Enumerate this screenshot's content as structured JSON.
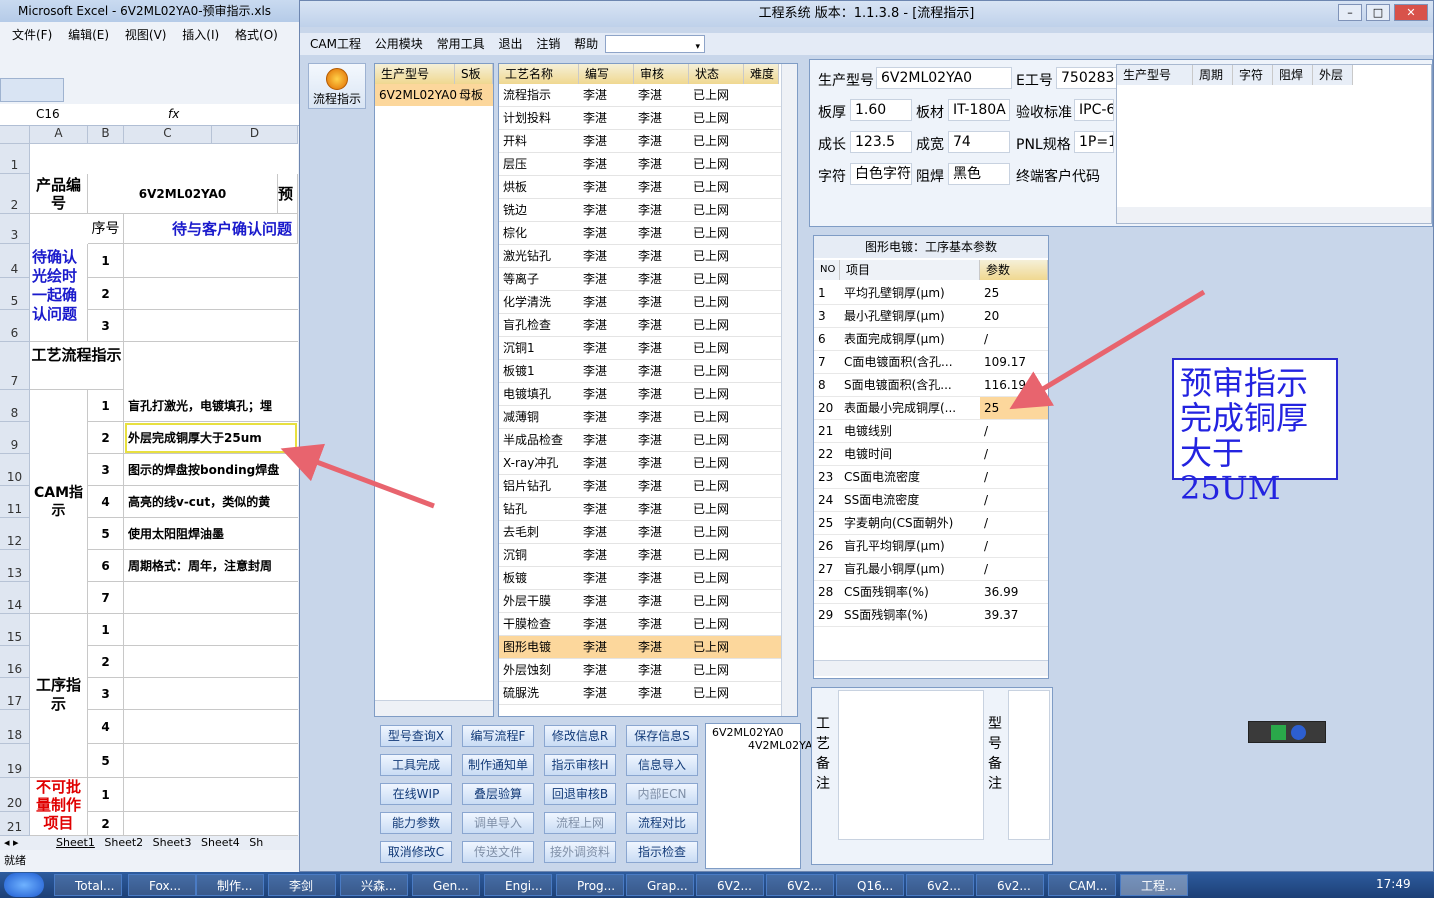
{
  "excel": {
    "title": "Microsoft Excel - 6V2ML02YA0-预审指示.xls",
    "menu": [
      "文件(F)",
      "编辑(E)",
      "视图(V)",
      "插入(I)",
      "格式(O)"
    ],
    "cellref": "C16",
    "fx": "fx",
    "cols": [
      "A",
      "B",
      "C",
      "D"
    ],
    "rows": [
      "1",
      "2",
      "3",
      "4",
      "5",
      "6",
      "7",
      "8",
      "9",
      "10",
      "11",
      "12",
      "13",
      "14",
      "15",
      "16",
      "17",
      "18",
      "19",
      "20",
      "21"
    ],
    "product_label": "产品编号",
    "product_no": "6V2ML02YA0",
    "pre": "预",
    "seq": "序号",
    "pending": "待与客户确认问题",
    "confirm_label": "待确认光绘时一起确认问题",
    "process_label": "工艺流程指示",
    "cam_label": "CAM指示",
    "step_label": "工序指示",
    "noprod_label": "不可批量制作项目",
    "nums": [
      "1",
      "2",
      "3",
      "1",
      "2",
      "3",
      "4",
      "5",
      "6",
      "7",
      "1",
      "2",
      "3",
      "4",
      "5",
      "1",
      "2"
    ],
    "cam_items": [
      "盲孔打激光，电镀填孔；埋",
      "外层完成铜厚大于25um",
      "图示的焊盘按bonding焊盘",
      "高亮的线v-cut，类似的黄",
      "使用太阳阻焊油墨",
      "周期格式：周年，注意封周"
    ],
    "sheets": [
      "Sheet1",
      "Sheet2",
      "Sheet3",
      "Sheet4",
      "Sh"
    ],
    "status": "就绪"
  },
  "app": {
    "title": "工程系统  版本：1.1.3.8 - [流程指示]",
    "menu": [
      "CAM工程",
      "公用模块",
      "常用工具",
      "退出",
      "注销",
      "帮助"
    ],
    "flow_btn": "流程指示",
    "model_hdr": [
      "生产型号",
      "S板"
    ],
    "model_row": [
      "6V2ML02YA0",
      "母板"
    ],
    "proc_hdr": [
      "工艺名称",
      "编写",
      "审核",
      "状态",
      "难度"
    ],
    "processes": [
      [
        "流程指示",
        "李湛",
        "李湛",
        "已上网"
      ],
      [
        "计划投料",
        "李湛",
        "李湛",
        "已上网"
      ],
      [
        "开料",
        "李湛",
        "李湛",
        "已上网"
      ],
      [
        "层压",
        "李湛",
        "李湛",
        "已上网"
      ],
      [
        "烘板",
        "李湛",
        "李湛",
        "已上网"
      ],
      [
        "铣边",
        "李湛",
        "李湛",
        "已上网"
      ],
      [
        "棕化",
        "李湛",
        "李湛",
        "已上网"
      ],
      [
        "激光钻孔",
        "李湛",
        "李湛",
        "已上网"
      ],
      [
        "等离子",
        "李湛",
        "李湛",
        "已上网"
      ],
      [
        "化学清洗",
        "李湛",
        "李湛",
        "已上网"
      ],
      [
        "盲孔检查",
        "李湛",
        "李湛",
        "已上网"
      ],
      [
        "沉铜1",
        "李湛",
        "李湛",
        "已上网"
      ],
      [
        "板镀1",
        "李湛",
        "李湛",
        "已上网"
      ],
      [
        "电镀填孔",
        "李湛",
        "李湛",
        "已上网"
      ],
      [
        "减薄铜",
        "李湛",
        "李湛",
        "已上网"
      ],
      [
        "半成品检查",
        "李湛",
        "李湛",
        "已上网"
      ],
      [
        "X-ray冲孔",
        "李湛",
        "李湛",
        "已上网"
      ],
      [
        "铝片钻孔",
        "李湛",
        "李湛",
        "已上网"
      ],
      [
        "钻孔",
        "李湛",
        "李湛",
        "已上网"
      ],
      [
        "去毛刺",
        "李湛",
        "李湛",
        "已上网"
      ],
      [
        "沉铜",
        "李湛",
        "李湛",
        "已上网"
      ],
      [
        "板镀",
        "李湛",
        "李湛",
        "已上网"
      ],
      [
        "外层干膜",
        "李湛",
        "李湛",
        "已上网"
      ],
      [
        "干膜检查",
        "李湛",
        "李湛",
        "已上网"
      ],
      [
        "图形电镀",
        "李湛",
        "李湛",
        "已上网"
      ],
      [
        "外层蚀刻",
        "李湛",
        "李湛",
        "已上网"
      ],
      [
        "硫脲洗",
        "李湛",
        "李湛",
        "已上网"
      ]
    ],
    "buttons": [
      [
        "型号查询X",
        "编写流程F",
        "修改信息R",
        "保存信息S"
      ],
      [
        "工具完成",
        "制作通知单",
        "指示审核H",
        "信息导入"
      ],
      [
        "在线WIP",
        "叠层验算",
        "回退审核B",
        "内部ECN"
      ],
      [
        "能力参数",
        "调单导入",
        "流程上网",
        "流程对比"
      ],
      [
        "取消修改C",
        "传送文件",
        "接外调资料",
        "指示检查"
      ]
    ],
    "disabled": [
      "内部ECN",
      "调单导入",
      "流程上网",
      "传送文件",
      "接外调资料"
    ],
    "tree": [
      "6V2ML02YA0",
      "4V2ML02YA"
    ],
    "info": {
      "model_label": "生产型号",
      "model": "6V2ML02YA0",
      "eng_label": "E工号",
      "eng": "750283",
      "thick_label": "板厚",
      "thick": "1.60",
      "mat_label": "板材",
      "mat": "IT-180A",
      "std_label": "验收标准",
      "std": "IPC-6",
      "len_label": "成长",
      "len": "123.5",
      "wid_label": "成宽",
      "wid": "74",
      "pnl_label": "PNL规格",
      "pnl": "1P=1",
      "char_label": "字符",
      "char": "白色字符",
      "mask_label": "阻焊",
      "mask": "黑色",
      "cust_label": "终端客户代码"
    },
    "right_hdr": [
      "生产型号",
      "周期",
      "字符",
      "阻焊",
      "外层"
    ],
    "param_title": "图形电镀：工序基本参数",
    "param_hdr": [
      "NO",
      "项目",
      "参数"
    ],
    "params": [
      [
        "1",
        "平均孔壁铜厚(μm)",
        "25"
      ],
      [
        "3",
        "最小孔壁铜厚(μm)",
        "20"
      ],
      [
        "6",
        "表面完成铜厚(μm)",
        "/"
      ],
      [
        "7",
        "C面电镀面积(含孔...",
        "109.17"
      ],
      [
        "8",
        "S面电镀面积(含孔...",
        "116.19"
      ],
      [
        "20",
        "表面最小完成铜厚(...",
        "25"
      ],
      [
        "21",
        "电镀线别",
        "/"
      ],
      [
        "22",
        "电镀时间",
        "/"
      ],
      [
        "23",
        "CS面电流密度",
        "/"
      ],
      [
        "24",
        "SS面电流密度",
        "/"
      ],
      [
        "25",
        "字麦朝向(CS面朝外)",
        "/"
      ],
      [
        "26",
        "盲孔平均铜厚(μm)",
        "/"
      ],
      [
        "27",
        "盲孔最小铜厚(μm)",
        "/"
      ],
      [
        "28",
        "CS面残铜率(%)",
        "36.99"
      ],
      [
        "29",
        "SS面残铜率(%)",
        "39.37"
      ]
    ],
    "note1": "工艺备注",
    "note2": "型号备注",
    "callout": [
      "预审指示",
      "完成铜厚",
      "大于25UM"
    ]
  },
  "taskbar": {
    "items": [
      "Total...",
      "Fox...",
      "制作...",
      "李剑",
      "兴森...",
      "Gen...",
      "Engi...",
      "Prog...",
      "Grap...",
      "6V2...",
      "6V2...",
      "Q16...",
      "6v2...",
      "6v2...",
      "CAM...",
      "工程..."
    ],
    "time": "17:49"
  },
  "colors": {
    "select": "#fcd79c",
    "callout": "#2323e0",
    "arrow": "#e8646e",
    "red": "#e00000",
    "blue": "#1a1acc"
  }
}
